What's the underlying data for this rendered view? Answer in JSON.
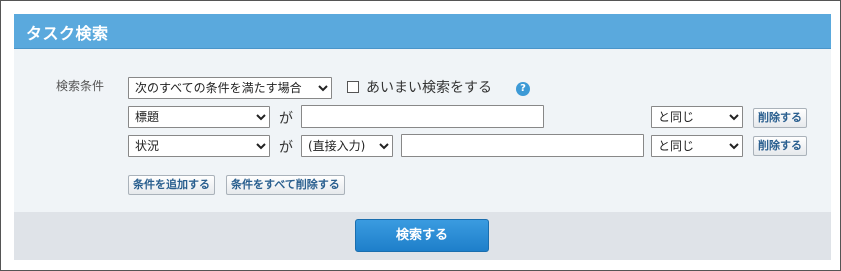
{
  "header": {
    "title": "タスク検索"
  },
  "criteria": {
    "label": "検索条件",
    "match_mode": "次のすべての条件を満たす場合",
    "fuzzy_label": "あいまい検索をする",
    "help_icon": "question-circle-icon",
    "rows": [
      {
        "field": "標題",
        "ga": "が",
        "input_value": "",
        "operator": "と同じ",
        "delete_label": "削除する"
      },
      {
        "field": "状況",
        "ga": "が",
        "value_select": "(直接入力)",
        "input_value": "",
        "operator": "と同じ",
        "delete_label": "削除する"
      }
    ],
    "add_label": "条件を追加する",
    "delete_all_label": "条件をすべて削除する"
  },
  "footer": {
    "search_label": "検索する"
  },
  "colors": {
    "header": "#5aa9dd",
    "search_button": "#1e7fca"
  }
}
